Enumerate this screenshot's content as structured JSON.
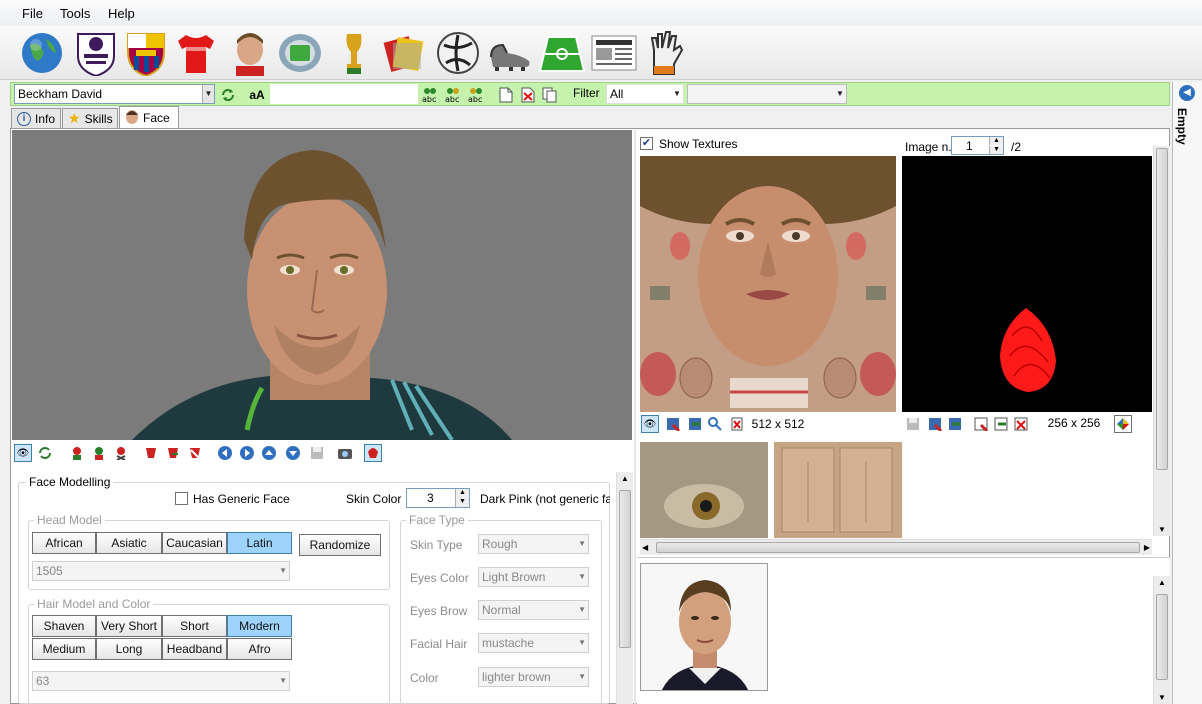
{
  "menu": {
    "file": "File",
    "tools": "Tools",
    "help": "Help"
  },
  "toolbar": {
    "icons": [
      "globe-icon",
      "premier-league-icon",
      "fc-barcelona-icon",
      "jersey-icon",
      "player-icon",
      "stadium-icon",
      "world-cup-icon",
      "cards-icon",
      "ball-icon",
      "boots-icon",
      "pitch-icon",
      "newspaper-icon",
      "gloves-icon"
    ]
  },
  "player_select": {
    "value": "Beckham David",
    "font_btn": "aA",
    "filter_label": "Filter",
    "filter_value": "All",
    "second_filter_value": ""
  },
  "tabs": [
    {
      "label": "Info"
    },
    {
      "label": "Skills"
    },
    {
      "label": "Face"
    }
  ],
  "side_panel": {
    "label": "Empty"
  },
  "face_modelling": {
    "title": "Face Modelling",
    "has_generic_face": "Has Generic Face",
    "skin_color_label": "Skin Color",
    "skin_color_value": "3",
    "skin_color_name": "Dark Pink (not generic face",
    "head_model": {
      "title": "Head Model",
      "buttons": [
        "African",
        "Asiatic",
        "Caucasian",
        "Latin"
      ],
      "selected": "Latin",
      "randomize": "Randomize",
      "value": "1505"
    },
    "hair_model": {
      "title": "Hair Model and Color",
      "buttons_row1": [
        "Shaven",
        "Very Short",
        "Short",
        "Modern"
      ],
      "buttons_row2": [
        "Medium",
        "Long",
        "Headband",
        "Afro"
      ],
      "selected": "Modern",
      "value": "63"
    },
    "face_type": {
      "title": "Face Type",
      "rows": [
        {
          "label": "Skin Type",
          "value": "Rough"
        },
        {
          "label": "Eyes Color",
          "value": "Light Brown"
        },
        {
          "label": "Eyes Brow",
          "value": "Normal"
        },
        {
          "label": "Facial Hair",
          "value": "mustache"
        },
        {
          "label": "Color",
          "value": "lighter brown"
        }
      ]
    }
  },
  "textures": {
    "show_textures": "Show Textures",
    "image_n_label": "Image n.",
    "image_n_value": "1",
    "image_total": "/2",
    "face_tex_size": "512 x 512",
    "hair_tex_size": "256 x 256"
  },
  "colors": {
    "accent_green": "#c5f3ad",
    "selected_blue": "#9ed3fb",
    "hair_red": "#ff1a1a"
  }
}
